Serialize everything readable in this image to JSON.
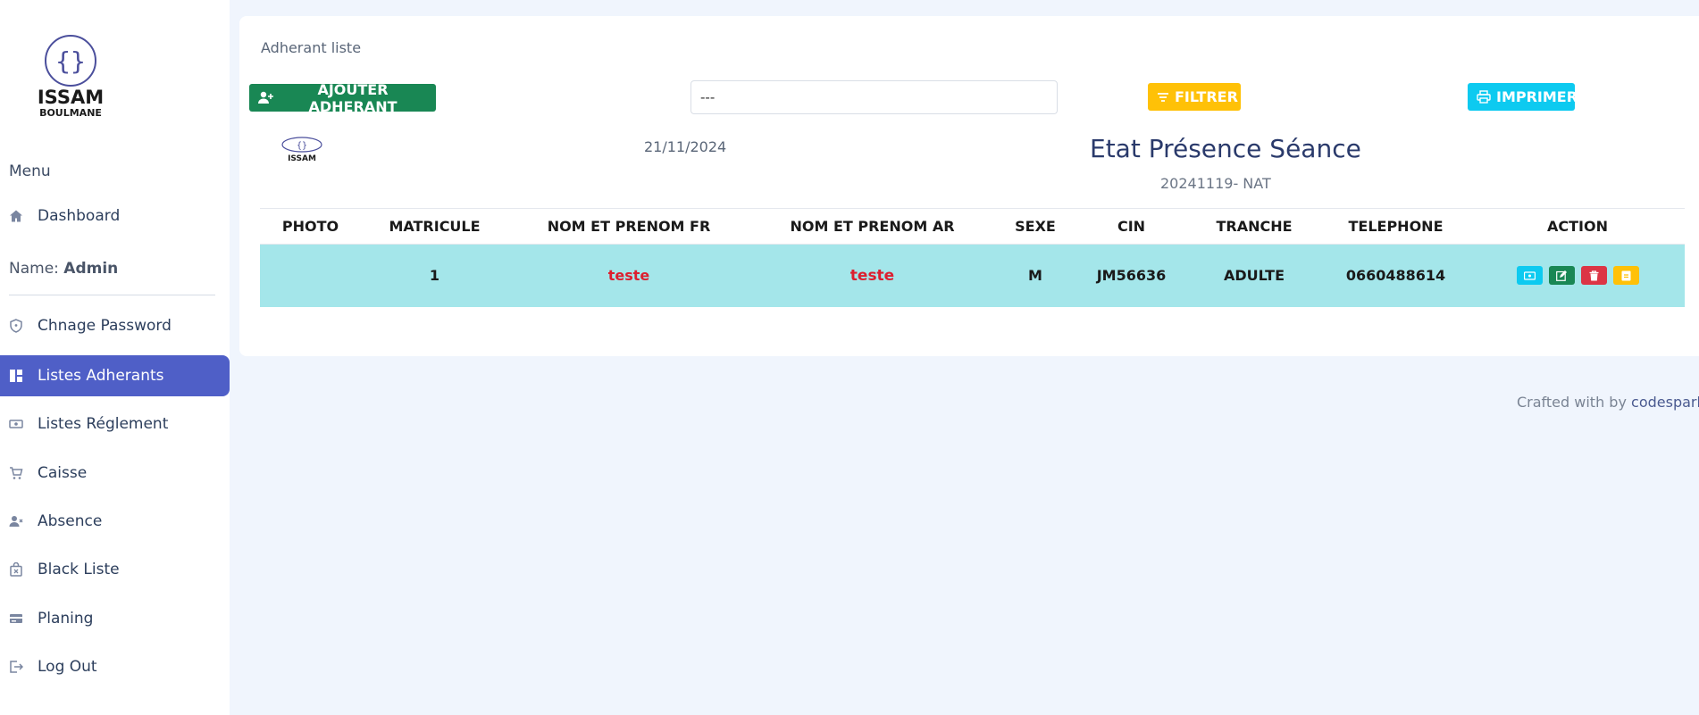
{
  "sidebar": {
    "brand_line1": "ISSAM",
    "brand_line2": "BOULMANE",
    "menu_title": "Menu",
    "name_label": "Name:",
    "name_value": "Admin",
    "items": [
      {
        "label": "Dashboard",
        "icon": "home-icon"
      },
      {
        "label": "Chnage Password",
        "icon": "shield-icon"
      },
      {
        "label": "Listes Adherants",
        "icon": "dashboard-grid-icon"
      },
      {
        "label": "Listes Réglement",
        "icon": "money-icon"
      },
      {
        "label": "Caisse",
        "icon": "cart-icon"
      },
      {
        "label": "Absence",
        "icon": "user-x-icon"
      },
      {
        "label": "Black Liste",
        "icon": "bag-x-icon"
      },
      {
        "label": "Planing",
        "icon": "card-icon"
      },
      {
        "label": "Log Out",
        "icon": "logout-icon"
      }
    ],
    "active_item": "Listes Adherants"
  },
  "main": {
    "breadcrumb": "Adherant liste",
    "add_button": "AJOUTER ADHERANT",
    "select_value": "---",
    "filter_button": "FILTRER",
    "print_button": "IMPRIMER",
    "report": {
      "date": "21/11/2024",
      "title": "Etat Présence Séance",
      "subtitle": "20241119- NAT"
    },
    "table": {
      "headers": [
        "PHOTO",
        "MATRICULE",
        "NOM ET PRENOM FR",
        "NOM ET PRENOM AR",
        "SEXE",
        "CIN",
        "TRANCHE",
        "TELEPHONE",
        "ACTION"
      ],
      "rows": [
        {
          "photo": "",
          "matricule": "1",
          "nom_fr": "teste",
          "nom_ar": "teste",
          "sexe": "M",
          "cin": "JM56636",
          "tranche": "ADULTE",
          "telephone": "0660488614"
        }
      ]
    }
  },
  "footer": {
    "text": "Crafted with by",
    "link": "codesparkhu"
  },
  "colors": {
    "active_nav": "#4f5fc7",
    "add_button": "#198754",
    "filter_button": "#ffc107",
    "print_button": "#0dcaf0",
    "row_bg": "#a4e6ea",
    "name_red": "#dc1f2f",
    "action_view": "#0dcaf0",
    "action_edit": "#198754",
    "action_delete": "#dc3545",
    "action_extra": "#ffc107"
  }
}
